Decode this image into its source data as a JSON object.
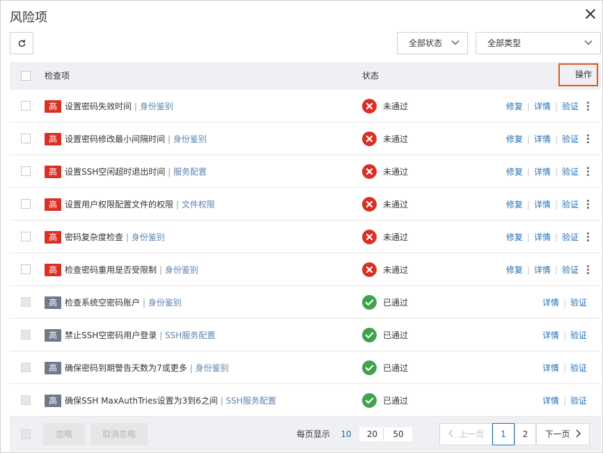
{
  "dialog": {
    "title": "风险项"
  },
  "filters": {
    "status_select": {
      "value": "全部状态"
    },
    "type_select": {
      "value": "全部类型"
    }
  },
  "table": {
    "headers": {
      "check_item": "检查项",
      "status": "状态",
      "action": "操作"
    },
    "rows": [
      {
        "level": "高",
        "level_color": "#d93026",
        "name": "设置密码失效时间",
        "category": "身份鉴别",
        "status": "未通过",
        "status_kind": "fail",
        "actions": [
          "修复",
          "详情",
          "验证"
        ],
        "selectable": true
      },
      {
        "level": "高",
        "level_color": "#d93026",
        "name": "设置密码修改最小间隔时间",
        "category": "身份鉴别",
        "status": "未通过",
        "status_kind": "fail",
        "actions": [
          "修复",
          "详情",
          "验证"
        ],
        "selectable": true
      },
      {
        "level": "高",
        "level_color": "#d93026",
        "name": "设置SSH空闲超时退出时间",
        "category": "服务配置",
        "status": "未通过",
        "status_kind": "fail",
        "actions": [
          "修复",
          "详情",
          "验证"
        ],
        "selectable": true
      },
      {
        "level": "高",
        "level_color": "#d93026",
        "name": "设置用户权限配置文件的权限",
        "category": "文件权限",
        "status": "未通过",
        "status_kind": "fail",
        "actions": [
          "修复",
          "详情",
          "验证"
        ],
        "selectable": true
      },
      {
        "level": "高",
        "level_color": "#d93026",
        "name": "密码复杂度检查",
        "category": "身份鉴别",
        "status": "未通过",
        "status_kind": "fail",
        "actions": [
          "修复",
          "详情",
          "验证"
        ],
        "selectable": true
      },
      {
        "level": "高",
        "level_color": "#d93026",
        "name": "检查密码重用是否受限制",
        "category": "身份鉴别",
        "status": "未通过",
        "status_kind": "fail",
        "actions": [
          "修复",
          "详情",
          "验证"
        ],
        "selectable": true
      },
      {
        "level": "高",
        "level_color": "#6c7a8c",
        "name": "检查系统空密码账户",
        "category": "身份鉴别",
        "status": "已通过",
        "status_kind": "pass",
        "actions": [
          "详情",
          "验证"
        ],
        "selectable": false
      },
      {
        "level": "高",
        "level_color": "#6c7a8c",
        "name": "禁止SSH空密码用户登录",
        "category": "SSH服务配置",
        "status": "已通过",
        "status_kind": "pass",
        "actions": [
          "详情",
          "验证"
        ],
        "selectable": false
      },
      {
        "level": "高",
        "level_color": "#6c7a8c",
        "name": "确保密码到期警告天数为7或更多",
        "category": "身份鉴别",
        "status": "已通过",
        "status_kind": "pass",
        "actions": [
          "详情",
          "验证"
        ],
        "selectable": false
      },
      {
        "level": "高",
        "level_color": "#6c7a8c",
        "name": "确保SSH MaxAuthTries设置为3到6之间",
        "category": "SSH服务配置",
        "status": "已通过",
        "status_kind": "pass",
        "actions": [
          "详情",
          "验证"
        ],
        "selectable": false
      }
    ]
  },
  "footer": {
    "ignore_label": "忽略",
    "unignore_label": "取消忽略",
    "per_page_label": "每页显示",
    "per_page_options": [
      "10",
      "20",
      "50"
    ],
    "per_page_selected": "10",
    "pagination": {
      "prev": "上一页",
      "pages": [
        "1",
        "2"
      ],
      "current": "1",
      "next": "下一页"
    }
  },
  "icons": {
    "refresh": "refresh-icon",
    "close": "close-icon",
    "caret": "chevron-down-icon",
    "fail": "x-circle-icon",
    "pass": "check-circle-icon",
    "more": "more-vertical-icon"
  }
}
